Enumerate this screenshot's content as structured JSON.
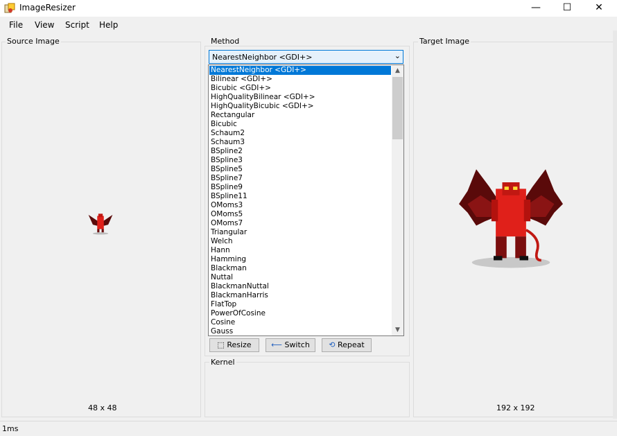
{
  "window": {
    "title": "ImageResizer",
    "minimize_glyph": "—",
    "maximize_glyph": "☐",
    "close_glyph": "✕"
  },
  "menu": [
    "File",
    "View",
    "Script",
    "Help"
  ],
  "source": {
    "label": "Source Image",
    "size": "48 x 48"
  },
  "method": {
    "label": "Method",
    "selected": "NearestNeighbor <GDI+>",
    "options": [
      "NearestNeighbor <GDI+>",
      "Bilinear <GDI+>",
      "Bicubic <GDI+>",
      "HighQualityBilinear <GDI+>",
      "HighQualityBicubic <GDI+>",
      "Rectangular",
      "Bicubic",
      "Schaum2",
      "Schaum3",
      "BSpline2",
      "BSpline3",
      "BSpline5",
      "BSpline7",
      "BSpline9",
      "BSpline11",
      "OMoms3",
      "OMoms5",
      "OMoms7",
      "Triangular",
      "Welch",
      "Hann",
      "Hamming",
      "Blackman",
      "Nuttal",
      "BlackmanNuttal",
      "BlackmanHarris",
      "FlatTop",
      "PowerOfCosine",
      "Cosine",
      "Gauss"
    ]
  },
  "buttons": {
    "resize": "Resize",
    "switch": "Switch",
    "repeat": "Repeat"
  },
  "kernel": {
    "label": "Kernel"
  },
  "target": {
    "label": "Target Image",
    "size": "192 x 192"
  },
  "status": {
    "text": "1ms"
  },
  "colors": {
    "accent": "#0078d7",
    "demon_red": "#e0201a",
    "demon_dark": "#5a0a0a"
  }
}
